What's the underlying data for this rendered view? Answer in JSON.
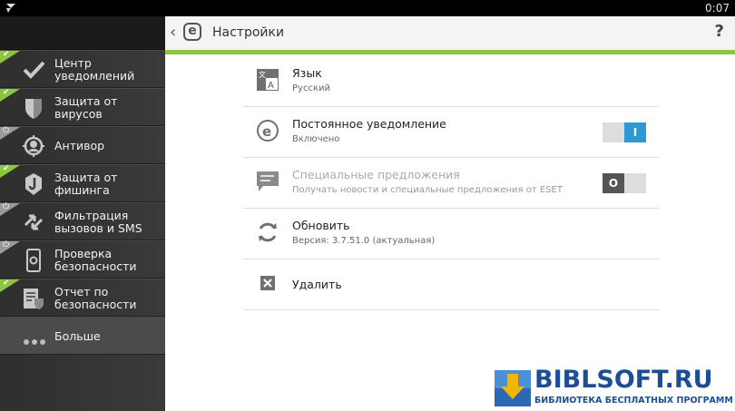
{
  "status_bar": {
    "time": "0:07"
  },
  "header": {
    "title": "Настройки",
    "help": "?"
  },
  "sidebar": {
    "items": [
      {
        "label": "Центр уведомлений",
        "corner": "check"
      },
      {
        "label": "Защита от вирусов",
        "corner": "check"
      },
      {
        "label": "Антивор",
        "corner": "power"
      },
      {
        "label": "Защита от фишинга",
        "corner": "check"
      },
      {
        "label": "Фильтрация вызовов и SMS",
        "corner": "power"
      },
      {
        "label": "Проверка безопасности",
        "corner": "power"
      },
      {
        "label": "Отчет по безопасности",
        "corner": "check"
      },
      {
        "label": "Больше",
        "corner": "none"
      }
    ]
  },
  "settings": {
    "language": {
      "title": "Язык",
      "subtitle": "Русский"
    },
    "notification": {
      "title": "Постоянное уведомление",
      "subtitle": "Включено",
      "toggle": "I"
    },
    "offers": {
      "title": "Специальные предложения",
      "subtitle": "Получать новости и специальные предложения от ESET",
      "toggle": "O"
    },
    "update": {
      "title": "Обновить",
      "subtitle": "Версия: 3.7.51.0 (актуальная)"
    },
    "delete": {
      "title": "Удалить"
    }
  },
  "watermark": {
    "title": "BIBLSOFT.RU",
    "subtitle": "БИБЛИОТЕКА БЕСПЛАТНЫХ ПРОГРАММ"
  },
  "colors": {
    "accent": "#8cc63f",
    "toggle_on": "#2d9ad6",
    "sidebar": "#333333"
  }
}
